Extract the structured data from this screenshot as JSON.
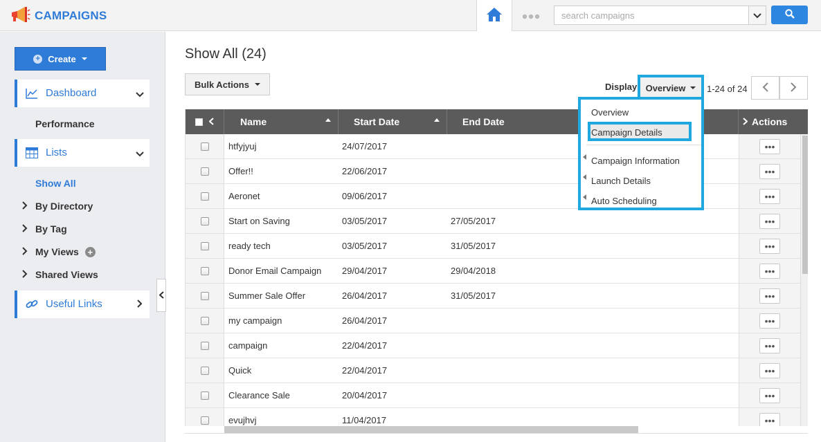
{
  "app": {
    "title": "CAMPAIGNS"
  },
  "search": {
    "placeholder": "search campaigns"
  },
  "icons": {
    "logo": "megaphone-icon",
    "home": "home-icon",
    "more": "more-dots-icon",
    "search": "search-icon"
  },
  "colors": {
    "accent": "#2f7bd8",
    "highlight": "#1fa8e0",
    "header": "#5b5b5b"
  },
  "sidebar": {
    "create_label": "Create",
    "dashboard_label": "Dashboard",
    "performance_label": "Performance",
    "lists_label": "Lists",
    "show_all_label": "Show All",
    "by_directory_label": "By Directory",
    "by_tag_label": "By Tag",
    "my_views_label": "My Views",
    "shared_views_label": "Shared Views",
    "useful_links_label": "Useful Links"
  },
  "main": {
    "title": "Show All (24)",
    "bulk_actions_label": "Bulk Actions",
    "display_label": "Display",
    "view_selected": "Overview",
    "pager_text": "1-24 of 24"
  },
  "dropdown": {
    "items": [
      "Overview",
      "Campaign Details",
      "Campaign Information",
      "Launch Details",
      "Auto Scheduling"
    ]
  },
  "table": {
    "headers": {
      "name": "Name",
      "start_date": "Start Date",
      "end_date": "End Date",
      "actions": "Actions"
    },
    "more_label": "•••",
    "rows": [
      {
        "name": "htfyjyuj",
        "start": "24/07/2017",
        "end": ""
      },
      {
        "name": "Offer!!",
        "start": "22/06/2017",
        "end": ""
      },
      {
        "name": "Aeronet",
        "start": "09/06/2017",
        "end": ""
      },
      {
        "name": "Start on Saving",
        "start": "03/05/2017",
        "end": "27/05/2017"
      },
      {
        "name": "ready tech",
        "start": "03/05/2017",
        "end": "31/05/2017"
      },
      {
        "name": "Donor Email Campaign",
        "start": "29/04/2017",
        "end": "29/04/2018"
      },
      {
        "name": "Summer Sale Offer",
        "start": "26/04/2017",
        "end": "31/05/2017"
      },
      {
        "name": "my campaign",
        "start": "26/04/2017",
        "end": ""
      },
      {
        "name": "campaign",
        "start": "22/04/2017",
        "end": ""
      },
      {
        "name": "Quick",
        "start": "22/04/2017",
        "end": ""
      },
      {
        "name": "Clearance Sale",
        "start": "20/04/2017",
        "end": ""
      },
      {
        "name": "evujhvj",
        "start": "11/04/2017",
        "end": ""
      }
    ]
  }
}
